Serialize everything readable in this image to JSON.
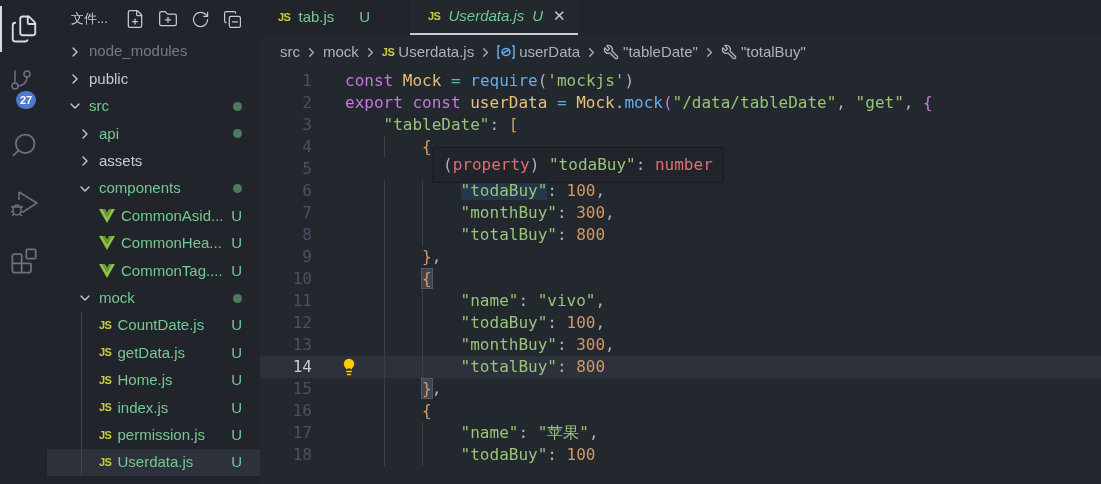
{
  "activity_bar": {
    "items": [
      {
        "kind": "explorer",
        "selected": true
      },
      {
        "kind": "source-control",
        "selected": false,
        "badge": "27"
      },
      {
        "kind": "search",
        "selected": false
      },
      {
        "kind": "run-debug",
        "selected": false
      },
      {
        "kind": "extensions",
        "selected": false
      }
    ]
  },
  "explorer": {
    "title": "文件...",
    "tree": [
      {
        "kind": "folder",
        "name": "node_modules",
        "expanded": false,
        "ignored": true,
        "modified": false,
        "dot": false
      },
      {
        "kind": "folder",
        "name": "public",
        "expanded": false,
        "ignored": false,
        "modified": false,
        "dot": false
      },
      {
        "kind": "folder",
        "name": "src",
        "expanded": true,
        "ignored": false,
        "modified": true,
        "dot": true,
        "children": [
          {
            "kind": "folder",
            "name": "api",
            "expanded": false,
            "ignored": false,
            "modified": true,
            "dot": true
          },
          {
            "kind": "folder",
            "name": "assets",
            "expanded": false,
            "ignored": false,
            "modified": false,
            "dot": false
          },
          {
            "kind": "folder",
            "name": "components",
            "expanded": true,
            "ignored": false,
            "modified": true,
            "dot": true,
            "children": [
              {
                "kind": "vue",
                "name": "CommonAsid...",
                "status": "U",
                "selected": false
              },
              {
                "kind": "vue",
                "name": "CommonHea...",
                "status": "U",
                "selected": false
              },
              {
                "kind": "vue",
                "name": "CommonTag....",
                "status": "U",
                "selected": false
              }
            ]
          },
          {
            "kind": "folder",
            "name": "mock",
            "expanded": true,
            "ignored": false,
            "modified": true,
            "dot": true,
            "children": [
              {
                "kind": "js",
                "badge": "JS",
                "name": "CountDate.js",
                "status": "U",
                "selected": false
              },
              {
                "kind": "js",
                "badge": "JS",
                "name": "getData.js",
                "status": "U",
                "selected": false
              },
              {
                "kind": "js",
                "badge": "JS",
                "name": "Home.js",
                "status": "U",
                "selected": false
              },
              {
                "kind": "js",
                "badge": "JS",
                "name": "index.js",
                "status": "U",
                "selected": false
              },
              {
                "kind": "js",
                "badge": "JS",
                "name": "permission.js",
                "status": "U",
                "selected": false
              },
              {
                "kind": "js",
                "badge": "JS",
                "name": "Userdata.js",
                "status": "U",
                "selected": true
              }
            ]
          }
        ]
      }
    ]
  },
  "tabs": [
    {
      "badge": "JS",
      "label": "tab.js",
      "status": "U",
      "selected": false,
      "preview": false
    },
    {
      "badge": "JS",
      "label": "Userdata.js",
      "status": "U",
      "selected": true,
      "preview": true,
      "close": "✕"
    }
  ],
  "breadcrumb": [
    {
      "kind": "folder",
      "label": "src"
    },
    {
      "kind": "folder",
      "label": "mock"
    },
    {
      "kind": "js",
      "badge": "JS",
      "label": "Userdata.js"
    },
    {
      "kind": "variable",
      "label": "userData"
    },
    {
      "kind": "property",
      "label": "\"tableDate\""
    },
    {
      "kind": "property",
      "label": "\"totalBuy\""
    }
  ],
  "editor": {
    "lines": [
      {
        "number": "1",
        "active": false,
        "tokens": [
          {
            "kind": "keyword",
            "text": "const "
          },
          {
            "kind": "class",
            "text": "Mock "
          },
          {
            "kind": "operator",
            "text": "= "
          },
          {
            "kind": "function",
            "text": "require"
          },
          {
            "kind": "plain",
            "text": "("
          },
          {
            "kind": "string",
            "text": "'mockjs'"
          },
          {
            "kind": "plain",
            "text": ")"
          }
        ]
      },
      {
        "number": "2",
        "active": false,
        "tokens": [
          {
            "kind": "keyword",
            "text": "export const "
          },
          {
            "kind": "class",
            "text": "userData "
          },
          {
            "kind": "operator",
            "text": "= "
          },
          {
            "kind": "class",
            "text": "Mock"
          },
          {
            "kind": "plain",
            "text": "."
          },
          {
            "kind": "function",
            "text": "mock"
          },
          {
            "kind": "bracket",
            "text": "("
          },
          {
            "kind": "string",
            "text": "\"/data/tableDate\""
          },
          {
            "kind": "plain",
            "text": ", "
          },
          {
            "kind": "string",
            "text": "\"get\""
          },
          {
            "kind": "plain",
            "text": ", "
          },
          {
            "kind": "bracket",
            "text": "{"
          }
        ]
      },
      {
        "number": "3",
        "active": false,
        "tokens": [
          {
            "kind": "string",
            "text": "    \"tableDate\""
          },
          {
            "kind": "plain",
            "text": ": "
          },
          {
            "kind": "brace",
            "text": "["
          }
        ]
      },
      {
        "number": "4",
        "active": false,
        "tokens": [
          {
            "kind": "brace",
            "text": "        {"
          }
        ]
      },
      {
        "number": "5",
        "active": false
      },
      {
        "number": "6",
        "active": false,
        "tokens": [
          {
            "kind": "string",
            "text": "            \"todaBuy\"",
            "highlighted": true
          },
          {
            "kind": "plain",
            "text": ": "
          },
          {
            "kind": "number",
            "text": "100"
          },
          {
            "kind": "plain",
            "text": ","
          }
        ]
      },
      {
        "number": "7",
        "active": false,
        "tokens": [
          {
            "kind": "string",
            "text": "            \"monthBuy\""
          },
          {
            "kind": "plain",
            "text": ": "
          },
          {
            "kind": "number",
            "text": "300"
          },
          {
            "kind": "plain",
            "text": ","
          }
        ]
      },
      {
        "number": "8",
        "active": false,
        "tokens": [
          {
            "kind": "string",
            "text": "            \"totalBuy\""
          },
          {
            "kind": "plain",
            "text": ": "
          },
          {
            "kind": "number",
            "text": "800"
          }
        ]
      },
      {
        "number": "9",
        "active": false,
        "tokens": [
          {
            "kind": "brace",
            "text": "        }"
          },
          {
            "kind": "plain",
            "text": ","
          }
        ]
      },
      {
        "number": "10",
        "active": false,
        "tokens": [
          {
            "kind": "brace",
            "text": "        {",
            "highlighted": true
          }
        ]
      },
      {
        "number": "11",
        "active": false,
        "tokens": [
          {
            "kind": "string",
            "text": "            \"name\""
          },
          {
            "kind": "plain",
            "text": ": "
          },
          {
            "kind": "string",
            "text": "\"vivo\""
          },
          {
            "kind": "plain",
            "text": ","
          }
        ]
      },
      {
        "number": "12",
        "active": false,
        "tokens": [
          {
            "kind": "string",
            "text": "            \"todaBuy\""
          },
          {
            "kind": "plain",
            "text": ": "
          },
          {
            "kind": "number",
            "text": "100"
          },
          {
            "kind": "plain",
            "text": ","
          }
        ]
      },
      {
        "number": "13",
        "active": false,
        "tokens": [
          {
            "kind": "string",
            "text": "            \"monthBuy\""
          },
          {
            "kind": "plain",
            "text": ": "
          },
          {
            "kind": "number",
            "text": "300"
          },
          {
            "kind": "plain",
            "text": ","
          }
        ]
      },
      {
        "number": "14",
        "active": true,
        "lightbulb": true,
        "tokens": [
          {
            "kind": "string",
            "text": "            \"totalBuy\""
          },
          {
            "kind": "plain",
            "text": ": "
          },
          {
            "kind": "number",
            "text": "800"
          }
        ]
      },
      {
        "number": "15",
        "active": false,
        "tokens": [
          {
            "kind": "brace",
            "text": "        }",
            "highlighted": true
          },
          {
            "kind": "plain",
            "text": ","
          }
        ]
      },
      {
        "number": "16",
        "active": false,
        "tokens": [
          {
            "kind": "brace",
            "text": "        {"
          }
        ]
      },
      {
        "number": "17",
        "active": false,
        "tokens": [
          {
            "kind": "string",
            "text": "            \"name\""
          },
          {
            "kind": "plain",
            "text": ": "
          },
          {
            "kind": "string",
            "text": "\"苹果\""
          },
          {
            "kind": "plain",
            "text": ","
          }
        ]
      },
      {
        "number": "18",
        "active": false,
        "tokens": [
          {
            "kind": "string",
            "text": "            \"todaBuy\""
          },
          {
            "kind": "plain",
            "text": ": "
          },
          {
            "kind": "number",
            "text": "100"
          }
        ]
      }
    ],
    "hover": {
      "tokens": [
        {
          "kind": "plain",
          "text": "("
        },
        {
          "kind": "type",
          "text": "property"
        },
        {
          "kind": "plain",
          "text": ") "
        },
        {
          "kind": "string",
          "text": "\"todaBuy\""
        },
        {
          "kind": "plain",
          "text": ": "
        },
        {
          "kind": "type",
          "text": "number"
        }
      ]
    }
  }
}
